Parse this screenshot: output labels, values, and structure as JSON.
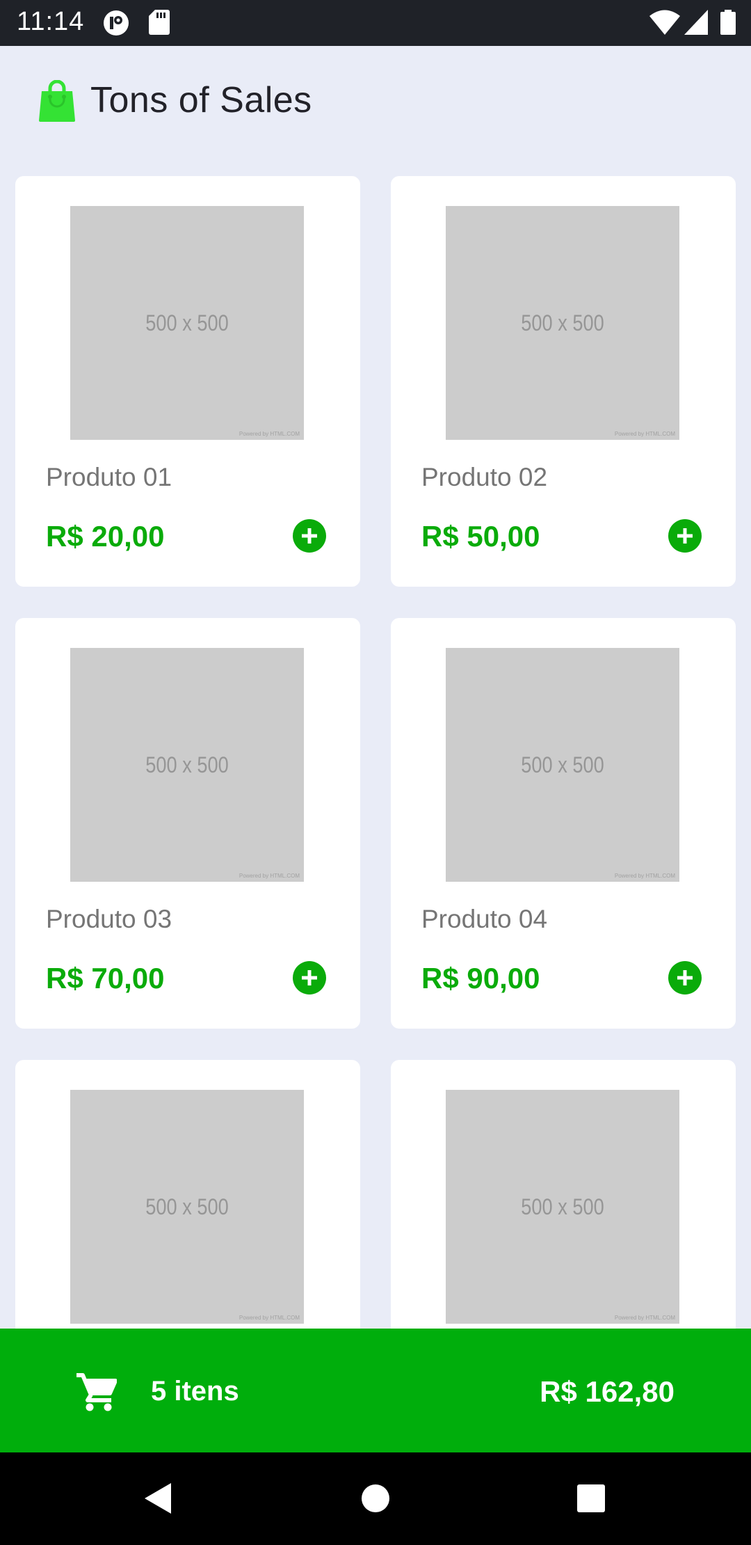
{
  "status_bar": {
    "time": "11:14",
    "icons": [
      "app-notification-icon",
      "sd-card-icon",
      "wifi-icon",
      "signal-icon",
      "battery-icon"
    ]
  },
  "header": {
    "title": "Tons of Sales",
    "icon": "shopping-bag-icon",
    "icon_color": "#34E234"
  },
  "products": [
    {
      "name": "Produto 01",
      "price": "R$ 20,00",
      "image_text": "500 x 500",
      "image_credit": "Powered by HTML.COM"
    },
    {
      "name": "Produto 02",
      "price": "R$ 50,00",
      "image_text": "500 x 500",
      "image_credit": "Powered by HTML.COM"
    },
    {
      "name": "Produto 03",
      "price": "R$ 70,00",
      "image_text": "500 x 500",
      "image_credit": "Powered by HTML.COM"
    },
    {
      "name": "Produto 04",
      "price": "R$ 90,00",
      "image_text": "500 x 500",
      "image_credit": "Powered by HTML.COM"
    },
    {
      "name": "",
      "price": "",
      "image_text": "500 x 500",
      "image_credit": "Powered by HTML.COM"
    },
    {
      "name": "",
      "price": "",
      "image_text": "500 x 500",
      "image_credit": "Powered by HTML.COM"
    }
  ],
  "cart": {
    "icon": "shopping-cart-icon",
    "count_label": "5 itens",
    "total": "R$ 162,80"
  },
  "nav": {
    "buttons": [
      "back-icon",
      "home-icon",
      "recents-icon"
    ]
  },
  "colors": {
    "accent_green": "#0AAB0A",
    "cart_bar": "#00AE0C",
    "background": "#E9ECF7"
  }
}
